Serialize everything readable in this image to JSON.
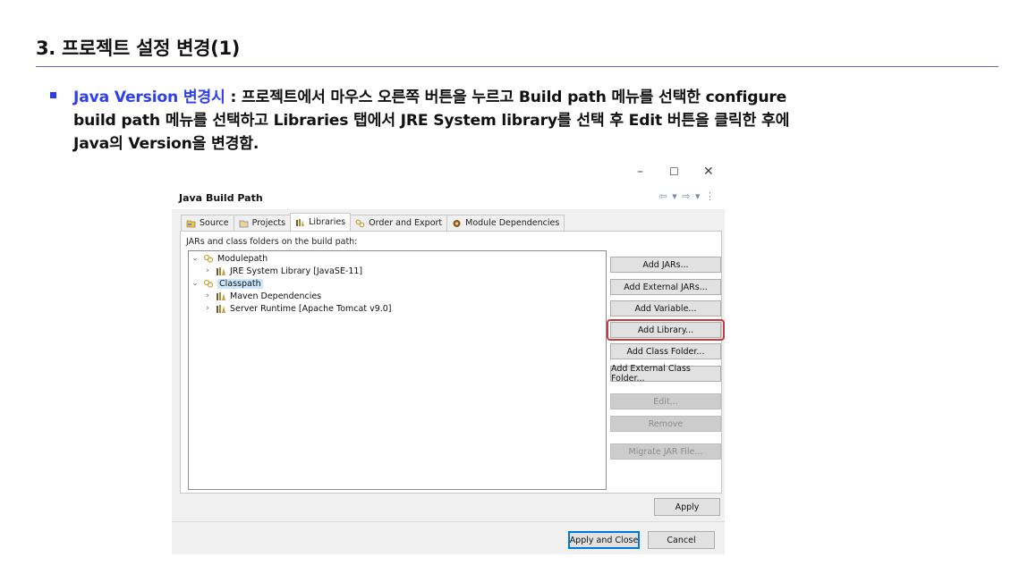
{
  "slide": {
    "title": "3. 프로젝트 설정 변경(1)",
    "bullet_em": "Java Version 변경시",
    "bullet_line1": " : 프로젝트에서 마우스 오른쪽 버튼을 누르고 Build path 메뉴를 선택한 configure",
    "bullet_line2": "build path 메뉴를 선택하고 Libraries 탭에서 JRE System library를 선택 후 Edit 버튼을 클릭한 후에",
    "bullet_line3": "Java의 Version을 변경함."
  },
  "window_controls": {
    "minimize": "–",
    "maximize": "☐",
    "close": "✕"
  },
  "dialog": {
    "title": "Java Build Path",
    "nav": "⇦ ▾ ⇨ ▾ ⋮",
    "tabs": [
      {
        "label": "Source",
        "icon": "source-folder-icon",
        "active": false
      },
      {
        "label": "Projects",
        "icon": "projects-icon",
        "active": false
      },
      {
        "label": "Libraries",
        "icon": "library-icon",
        "active": true
      },
      {
        "label": "Order and Export",
        "icon": "order-export-icon",
        "active": false
      },
      {
        "label": "Module Dependencies",
        "icon": "module-icon",
        "active": false
      }
    ],
    "panel_label": "JARs and class folders on the build path:",
    "tree": {
      "modulepath": "Modulepath",
      "jre": "JRE System Library [JavaSE-11]",
      "classpath": "Classpath",
      "maven": "Maven Dependencies",
      "server": "Server Runtime [Apache Tomcat v9.0]"
    },
    "buttons": {
      "add_jars": "Add JARs...",
      "add_external_jars": "Add External JARs...",
      "add_variable": "Add Variable...",
      "add_library": "Add Library...",
      "add_class_folder": "Add Class Folder...",
      "add_external_class_folder": "Add External Class Folder...",
      "edit": "Edit...",
      "remove": "Remove",
      "migrate_jar": "Migrate JAR File..."
    },
    "apply": "Apply",
    "apply_and_close": "Apply and Close",
    "cancel": "Cancel"
  },
  "colors": {
    "accent_blue": "#2f3fea",
    "highlight_red": "#c53a3a",
    "selection": "#cce8ff"
  }
}
